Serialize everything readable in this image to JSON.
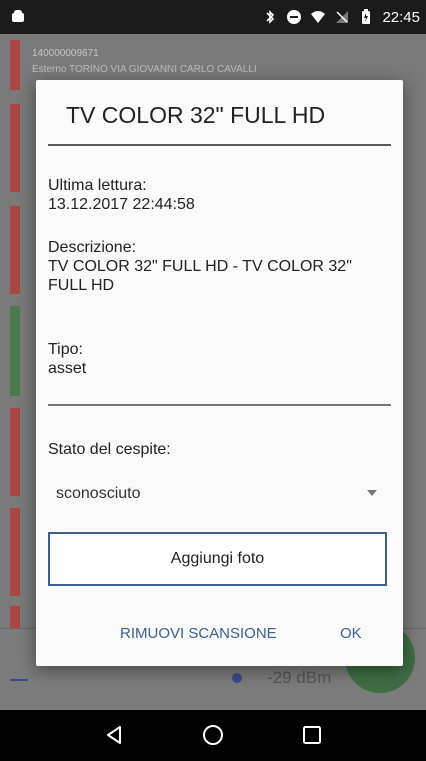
{
  "status_bar": {
    "time": "22:45"
  },
  "background": {
    "first_item_code": "140000009671",
    "first_item_sub": "Esterno TORINO VIA GIOVANNI CARLO CAVALLI",
    "rssi_text": "-29 dBm"
  },
  "dialog": {
    "title": "TV COLOR 32\" FULL HD",
    "last_read_label": "Ultima lettura:",
    "last_read_value": "13.12.2017 22:44:58",
    "description_label": "Descrizione:",
    "description_value": "TV COLOR 32\" FULL HD - TV COLOR 32\" FULL HD",
    "type_label": "Tipo:",
    "type_value": "asset",
    "state_label": "Stato del cespite:",
    "state_value": "sconosciuto",
    "add_photo_label": "Aggiungi foto",
    "remove_label": "RIMUOVI SCANSIONE",
    "ok_label": "OK"
  },
  "colors": {
    "accent": "#3c5f8e",
    "strip_red": "#a94747",
    "strip_green": "#4a7a4f"
  }
}
